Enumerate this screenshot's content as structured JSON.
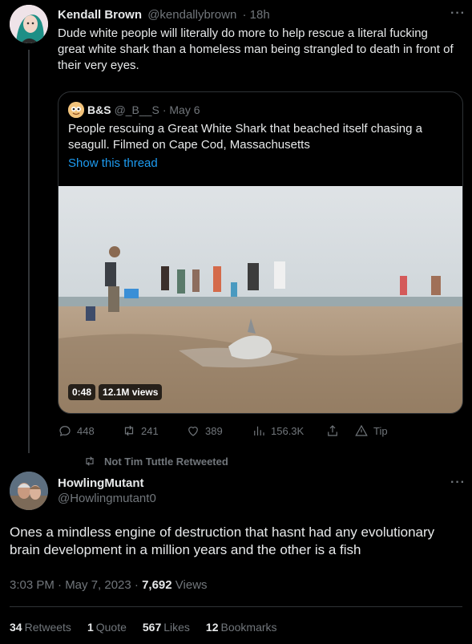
{
  "tweet": {
    "author_name": "Kendall Brown",
    "author_handle": "@kendallybrown",
    "time": "· 18h",
    "text": "Dude white people will literally do more to help rescue a literal fucking great white shark than a homeless man being strangled to death in front of their very eyes.",
    "more_label": "···"
  },
  "quote": {
    "author_name": "B&S",
    "author_handle": "@_B__S",
    "time": "· May 6",
    "text": "People rescuing a Great White Shark that beached itself chasing a seagull. Filmed on Cape Cod, Massachusetts",
    "link_text": "Show this thread",
    "video_duration": "0:48",
    "video_views": "12.1M views"
  },
  "actions": {
    "replies": "448",
    "retweets": "241",
    "likes": "389",
    "views": "156.3K",
    "tip": "Tip",
    "icons": [
      "reply-icon",
      "retweet-icon",
      "like-icon",
      "views-icon",
      "share-icon",
      "tip-icon"
    ]
  },
  "retweet_banner": {
    "text": "Not Tim Tuttle Retweeted"
  },
  "reply_tweet": {
    "author_name": "HowlingMutant",
    "author_handle": "@Howlingmutant0",
    "text": "Ones a mindless engine of destruction that hasnt had any evolutionary brain development in a million years and the other is a fish",
    "timestamp": "3:03 PM · May 7, 2023 · ",
    "views_count": "7,692",
    "views_label": " Views",
    "more_label": "···"
  },
  "stats": {
    "retweets_count": "34",
    "retweets_label": "Retweets",
    "quotes_count": "1",
    "quotes_label": "Quote",
    "likes_count": "567",
    "likes_label": "Likes",
    "bookmarks_count": "12",
    "bookmarks_label": "Bookmarks"
  },
  "colors": {
    "background": "#000000",
    "text": "#e7e9ea",
    "secondary": "#71767b",
    "link": "#1d9bf0",
    "border": "#2f3336"
  }
}
